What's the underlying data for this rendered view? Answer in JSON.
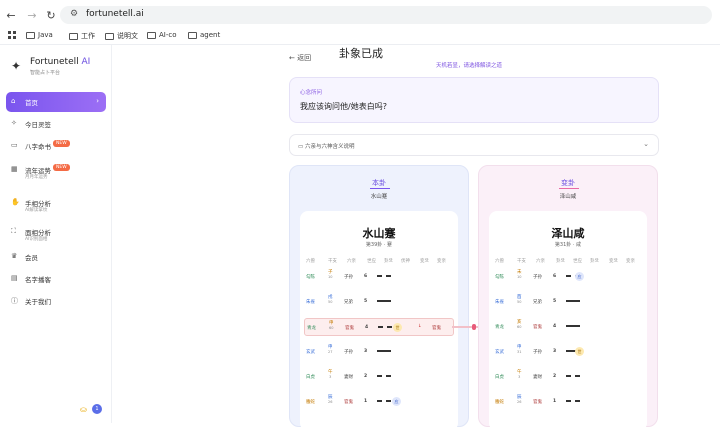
{
  "browser": {
    "url": "fortunetell.ai",
    "bookmarks": [
      "Java",
      "工作",
      "说明文",
      "AI-co",
      "agent"
    ]
  },
  "sidebar": {
    "brand": "Fortunetell",
    "brand_accent": "AI",
    "brand_sub": "智能占卜平台",
    "items": [
      {
        "label": "首页",
        "icon": "home-icon",
        "active": true
      },
      {
        "label": "今日灵签",
        "icon": "sparkle-icon"
      },
      {
        "label": "八字命书",
        "icon": "book-icon",
        "badge": "NEW"
      },
      {
        "label": "流年运势",
        "icon": "calendar-icon",
        "badge": "NEW",
        "sub": "月月年运势"
      },
      {
        "label": "手相分析",
        "icon": "hand-icon",
        "sub": "AI解读掌纹"
      },
      {
        "label": "面相分析",
        "icon": "face-scan-icon",
        "sub": "AI识别面相"
      },
      {
        "label": "会员",
        "icon": "crown-icon"
      },
      {
        "label": "名字播客",
        "icon": "document-icon"
      },
      {
        "label": "关于我们",
        "icon": "info-icon"
      }
    ],
    "avatar_initial": "1"
  },
  "main": {
    "back_label": "返回",
    "title": "卦象已成",
    "subtitle": "天机若显，请选择解读之道",
    "question_label": "心念所问",
    "question_text": "我应该询问他/她表白吗?",
    "expander_label": "六亲与六神含义说明"
  },
  "left": {
    "head": "本卦",
    "name": "水山蹇",
    "card_name": "水山蹇",
    "card_num": "第39卦 · 蹇",
    "columns": [
      "六兽",
      "干支",
      "六亲",
      "世应",
      "卦爻",
      "伏神",
      "变爻",
      "变亲"
    ],
    "rows": [
      {
        "beast": "勾陈",
        "gz1": "子",
        "gz2": "10",
        "kin": "子孙",
        "num": "6",
        "yao": "broken"
      },
      {
        "beast": "朱雀",
        "gz1": "戌",
        "gz2": "50",
        "kin": "兄弟",
        "num": "5",
        "yao": "solid"
      },
      {
        "beast": "青龙",
        "gz1": "申",
        "gz2": "60",
        "kin": "官鬼",
        "num": "4",
        "yao": "broken",
        "hl": true,
        "mark": "世",
        "change": "官鬼"
      },
      {
        "beast": "玄武",
        "gz1": "申",
        "gz2": "27",
        "kin": "子孙",
        "num": "3",
        "yao": "solid"
      },
      {
        "beast": "白虎",
        "gz1": "午",
        "gz2": "3",
        "kin": "妻财",
        "num": "2",
        "yao": "broken"
      },
      {
        "beast": "螣蛇",
        "gz1": "辰",
        "gz2": "26",
        "kin": "官鬼",
        "num": "1",
        "yao": "broken",
        "mark": "应"
      }
    ]
  },
  "right": {
    "head": "变卦",
    "name": "泽山咸",
    "card_name": "泽山咸",
    "card_num": "第31卦 · 咸",
    "columns": [
      "六兽",
      "干支",
      "六亲",
      "卦爻",
      "世应",
      "卦爻",
      "变爻",
      "变亲"
    ],
    "rows": [
      {
        "beast": "勾陈",
        "gz1": "未",
        "gz2": "10",
        "kin": "子孙",
        "num": "6",
        "yao": "broken",
        "mark": "应"
      },
      {
        "beast": "朱雀",
        "gz1": "酉",
        "gz2": "50",
        "kin": "兄弟",
        "num": "5",
        "yao": "solid"
      },
      {
        "beast": "青龙",
        "gz1": "亥",
        "gz2": "60",
        "kin": "官鬼",
        "num": "4",
        "yao": "solid"
      },
      {
        "beast": "玄武",
        "gz1": "申",
        "gz2": "31",
        "kin": "子孙",
        "num": "3",
        "yao": "solid",
        "mark": "世"
      },
      {
        "beast": "白虎",
        "gz1": "午",
        "gz2": "3",
        "kin": "妻财",
        "num": "2",
        "yao": "broken"
      },
      {
        "beast": "螣蛇",
        "gz1": "辰",
        "gz2": "26",
        "kin": "官鬼",
        "num": "1",
        "yao": "broken"
      }
    ]
  }
}
